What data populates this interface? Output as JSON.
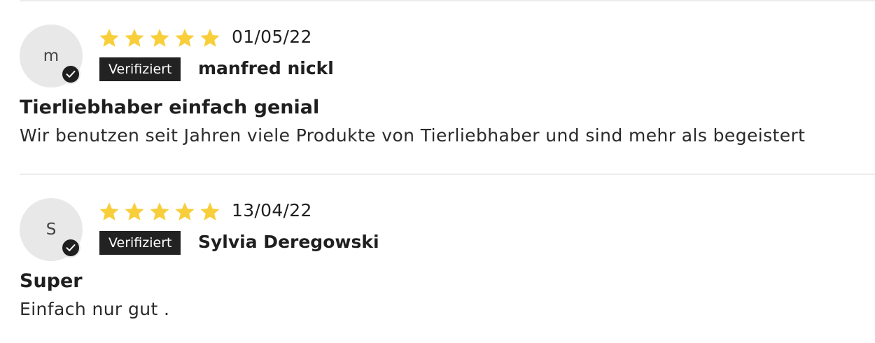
{
  "reviews": [
    {
      "avatar_letter": "m",
      "rating": 5,
      "date": "01/05/22",
      "verified_label": "Verifiziert",
      "author": "manfred nickl",
      "title": "Tierliebhaber einfach genial",
      "body": "Wir benutzen seit Jahren viele Produkte von Tierliebhaber und sind mehr als begeistert"
    },
    {
      "avatar_letter": "S",
      "rating": 5,
      "date": "13/04/22",
      "verified_label": "Verifiziert",
      "author": "Sylvia Deregowski",
      "title": "Super",
      "body": "Einfach nur gut ."
    }
  ],
  "colors": {
    "star": "#f8ce3b",
    "badge_background": "#222222",
    "avatar_background": "#e8e8e8",
    "divider": "#ececec"
  },
  "icons": {
    "star": "star-icon",
    "verified": "check-icon"
  }
}
